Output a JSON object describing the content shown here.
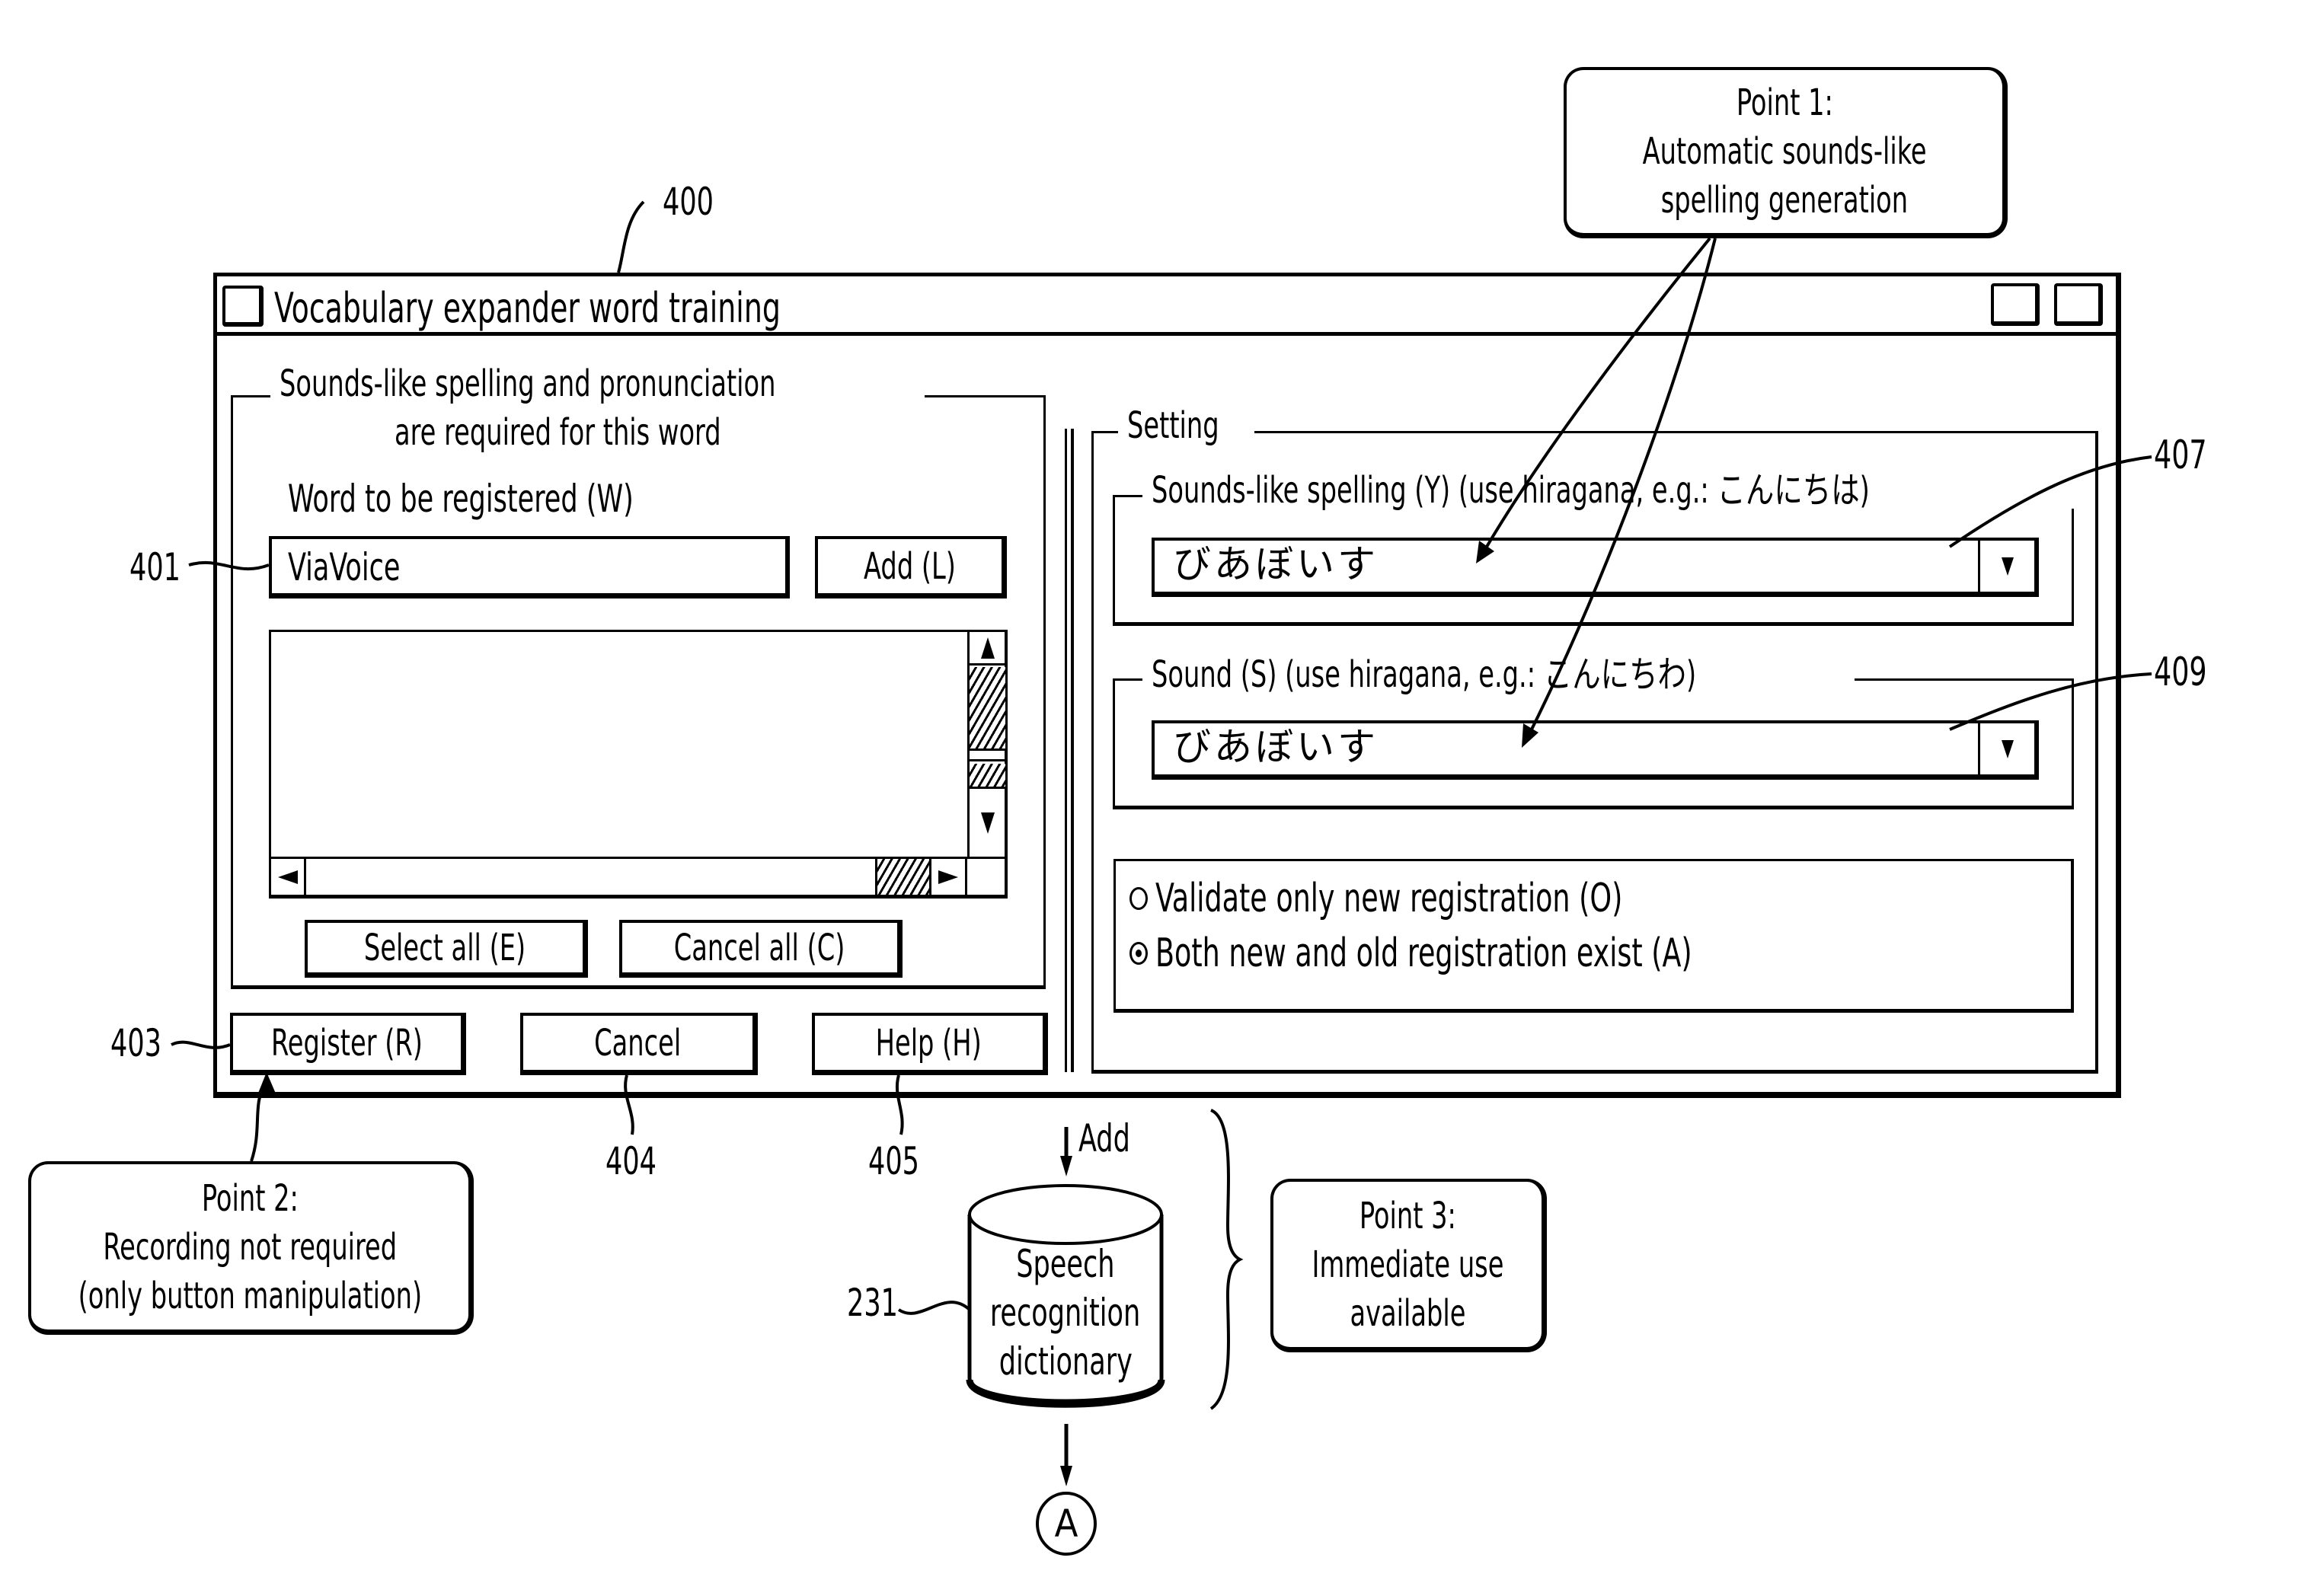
{
  "window": {
    "title": "Vocabulary expander word training",
    "ref": "400"
  },
  "left_group": {
    "legend_line1": "Sounds-like spelling and pronunciation",
    "legend_line2": "are required for this word",
    "word_label": "Word to be registered (W)",
    "word_value": "ViaVoice",
    "word_ref": "401",
    "add_button": "Add (L)",
    "select_all_button": "Select all (E)",
    "cancel_all_button": "Cancel all (C)"
  },
  "bottom_buttons": {
    "register": "Register (R)",
    "register_ref": "403",
    "cancel": "Cancel",
    "cancel_ref": "404",
    "help": "Help (H)",
    "help_ref": "405"
  },
  "setting": {
    "legend": "Setting",
    "sounds_like": {
      "legend": "Sounds-like spelling (Y)  (use hiragana, e.g.: こんにちは)",
      "value": "びあぼいす",
      "ref": "407"
    },
    "sound": {
      "legend": "Sound  (S)  (use hiragana, e.g.: こんにちわ)",
      "value": "びあぼいす",
      "ref": "409"
    },
    "radio_options": [
      {
        "label": "Validate only new registration (O)",
        "selected": false
      },
      {
        "label": "Both new and old registration exist (A)",
        "selected": true
      }
    ]
  },
  "callouts": {
    "point1": [
      "Point 1:",
      "Automatic sounds-like",
      "spelling generation"
    ],
    "point2": [
      "Point 2:",
      "Recording not required",
      "(only button manipulation)"
    ],
    "point3": [
      "Point 3:",
      "Immediate use",
      "available"
    ]
  },
  "dictionary": {
    "lines": [
      "Speech",
      "recognition",
      "dictionary"
    ],
    "ref": "231",
    "add_label": "Add",
    "connector": "A"
  }
}
